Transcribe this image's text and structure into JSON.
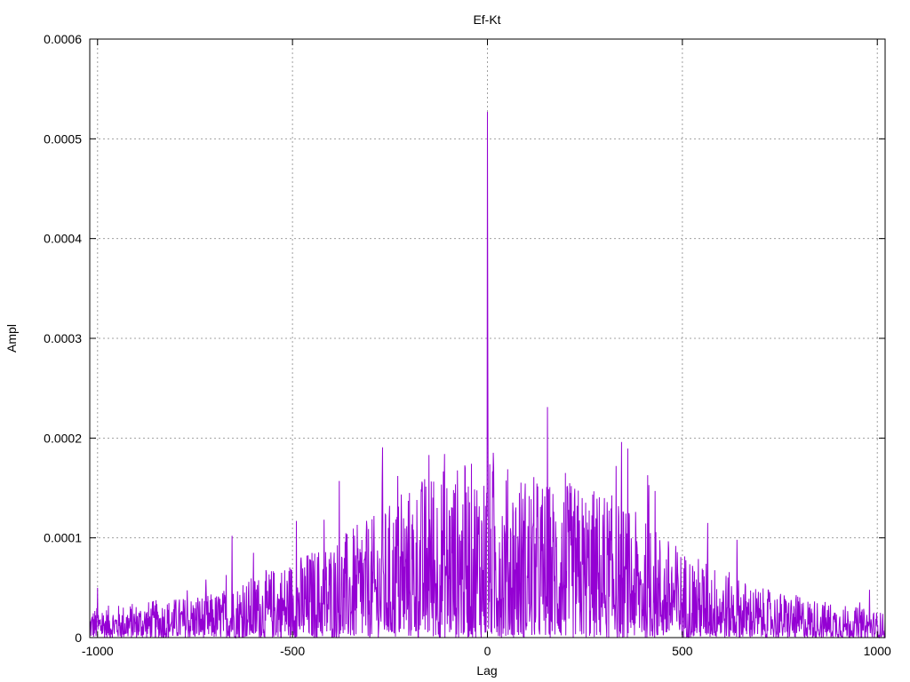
{
  "chart_data": {
    "type": "line",
    "title": "Ef-Kt",
    "xlabel": "Lag",
    "ylabel": "Ampl",
    "xlim": [
      -1020,
      1020
    ],
    "ylim": [
      0,
      0.0006
    ],
    "x_ticks": [
      -1000,
      -500,
      0,
      500,
      1000
    ],
    "x_tick_labels": [
      "-1000",
      "-500",
      "0",
      "500",
      "1000"
    ],
    "y_ticks": [
      0,
      0.0001,
      0.0002,
      0.0003,
      0.0004,
      0.0005,
      0.0006
    ],
    "y_tick_labels": [
      "0",
      "0.0001",
      "0.0002",
      "0.0003",
      "0.0004",
      "0.0005",
      "0.0006"
    ],
    "grid": true,
    "line_color": "#9400d3",
    "series": [
      {
        "x_start": -1020,
        "x_end": 1020,
        "x_step": 1,
        "envelope_points": [
          [
            -1020,
            3e-05
          ],
          [
            -700,
            4.5e-05
          ],
          [
            -500,
            8e-05
          ],
          [
            -300,
            0.00012
          ],
          [
            -150,
            0.00017
          ],
          [
            0,
            0.00018
          ],
          [
            150,
            0.00016
          ],
          [
            300,
            0.00015
          ],
          [
            500,
            9e-05
          ],
          [
            700,
            5e-05
          ],
          [
            1020,
            2.5e-05
          ]
        ],
        "peaks": [
          {
            "x": 0,
            "y": 0.000527
          },
          {
            "x": 1,
            "y": 0.000277
          },
          {
            "x": -150,
            "y": 0.000183
          },
          {
            "x": -110,
            "y": 0.000184
          },
          {
            "x": -230,
            "y": 0.000162
          },
          {
            "x": 330,
            "y": 0.000172
          },
          {
            "x": -380,
            "y": 0.000157
          },
          {
            "x": 430,
            "y": 0.000147
          },
          {
            "x": 200,
            "y": 0.000165
          },
          {
            "x": -270,
            "y": 0.000154
          },
          {
            "x": -490,
            "y": 0.000117
          },
          {
            "x": 565,
            "y": 0.000115
          },
          {
            "x": -655,
            "y": 0.000102
          },
          {
            "x": -600,
            "y": 8.5e-05
          },
          {
            "x": 640,
            "y": 9.8e-05
          },
          {
            "x": -1000,
            "y": 5e-05
          },
          {
            "x": 980,
            "y": 4.8e-05
          }
        ]
      }
    ]
  }
}
